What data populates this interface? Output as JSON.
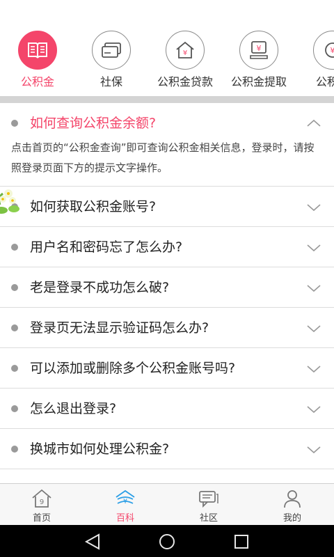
{
  "categories": [
    {
      "label": "公积金",
      "icon": "book-icon",
      "active": true
    },
    {
      "label": "社保",
      "icon": "card-icon",
      "active": false
    },
    {
      "label": "公积金贷款",
      "icon": "house-yen-icon",
      "active": false
    },
    {
      "label": "公积金提取",
      "icon": "yen-withdraw-icon",
      "active": false
    },
    {
      "label": "公积金",
      "icon": "yen-circle-icon",
      "active": false
    }
  ],
  "faq": {
    "items": [
      {
        "question": "如何查询公积金余额?",
        "answer": "点击首页的“公积金查询”即可查询公积金相关信息，登录时，请按照登录页面下方的提示文字操作。",
        "expanded": true
      },
      {
        "question": "如何获取公积金账号?"
      },
      {
        "question": "用户名和密码忘了怎么办?"
      },
      {
        "question": "老是登录不成功怎么破?"
      },
      {
        "question": "登录页无法显示验证码怎么办?"
      },
      {
        "question": "可以添加或删除多个公积金账号吗?"
      },
      {
        "question": "怎么退出登录?"
      },
      {
        "question": "换城市如何处理公积金?"
      }
    ]
  },
  "tabbar": {
    "tabs": [
      {
        "label": "首页",
        "icon": "home-icon",
        "active": false
      },
      {
        "label": "百科",
        "icon": "encyclopedia-icon",
        "active": true
      },
      {
        "label": "社区",
        "icon": "chat-icon",
        "active": false
      },
      {
        "label": "我的",
        "icon": "user-icon",
        "active": false
      }
    ]
  },
  "colors": {
    "accent": "#f4456a",
    "divider": "#d4d4d4",
    "icon_gray": "#8a8a8a"
  }
}
